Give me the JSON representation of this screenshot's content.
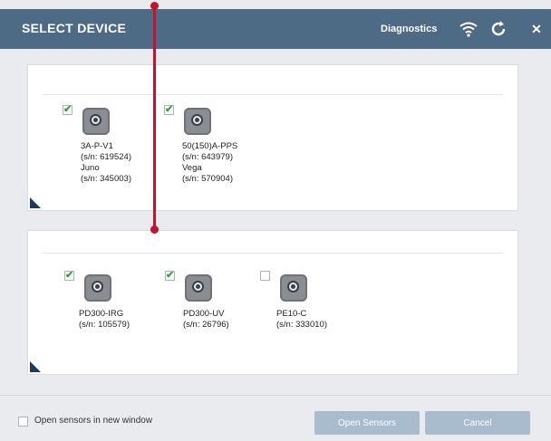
{
  "window": {
    "title": "SELECT DEVICE",
    "diagnostics_label": "Diagnostics",
    "icons": [
      "wifi-icon",
      "refresh-icon",
      "close-icon"
    ],
    "close_glyph": "✕"
  },
  "groups": [
    {
      "devices": [
        {
          "lines": [
            "3A-P-V1",
            "(s/n: 619524)",
            "Juno",
            "(s/n: 345003)"
          ],
          "checked": true
        },
        {
          "lines": [
            "50(150)A-PPS",
            "(s/n: 643979)",
            "Vega",
            "(s/n: 570904)"
          ],
          "checked": true
        }
      ]
    },
    {
      "devices": [
        {
          "lines": [
            "PD300-IRG",
            "(s/n: 105579)"
          ],
          "checked": true
        },
        {
          "lines": [
            "PD300-UV",
            "(s/n: 26796)"
          ],
          "checked": true
        },
        {
          "lines": [
            "PE10-C",
            "(s/n: 333010)"
          ],
          "checked": false
        }
      ]
    }
  ],
  "footer": {
    "open_new_window_label": "Open sensors in new window",
    "open_new_window_checked": false,
    "open_button": "Open Sensors",
    "cancel_button": "Cancel"
  },
  "colors": {
    "titlebar": "#4d6b85",
    "button": "#a9bccd",
    "check": "#2fa23a",
    "annotation": "#c8102e"
  }
}
